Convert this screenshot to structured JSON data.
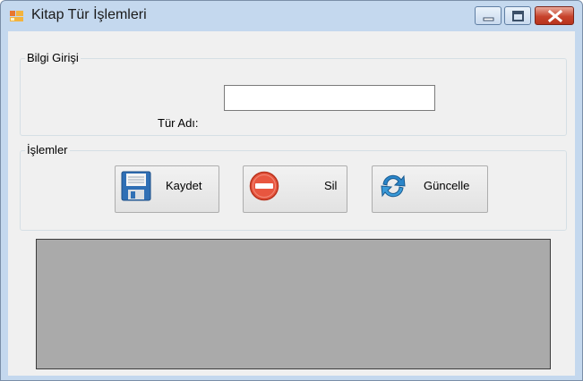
{
  "window": {
    "title": "Kitap Tür İşlemleri",
    "icon": "form-icon",
    "controls": [
      "minimize-icon",
      "maximize-icon",
      "close-icon"
    ]
  },
  "group_info": {
    "legend": "Bilgi Girişi",
    "field_label": "Tür Adı:",
    "field_value": ""
  },
  "group_actions": {
    "legend": "İşlemler",
    "buttons": [
      {
        "label": "Kaydet",
        "icon": "floppy-disk-icon"
      },
      {
        "label": "Sil",
        "icon": "delete-minus-icon"
      },
      {
        "label": "Güncelle",
        "icon": "refresh-icon"
      }
    ]
  },
  "grid": {
    "rows": []
  },
  "colors": {
    "title_bar": "#c4d8ee",
    "client_background": "#f0f0f0",
    "grid_background": "#aaaaaa",
    "close_button": "#c7432c"
  }
}
